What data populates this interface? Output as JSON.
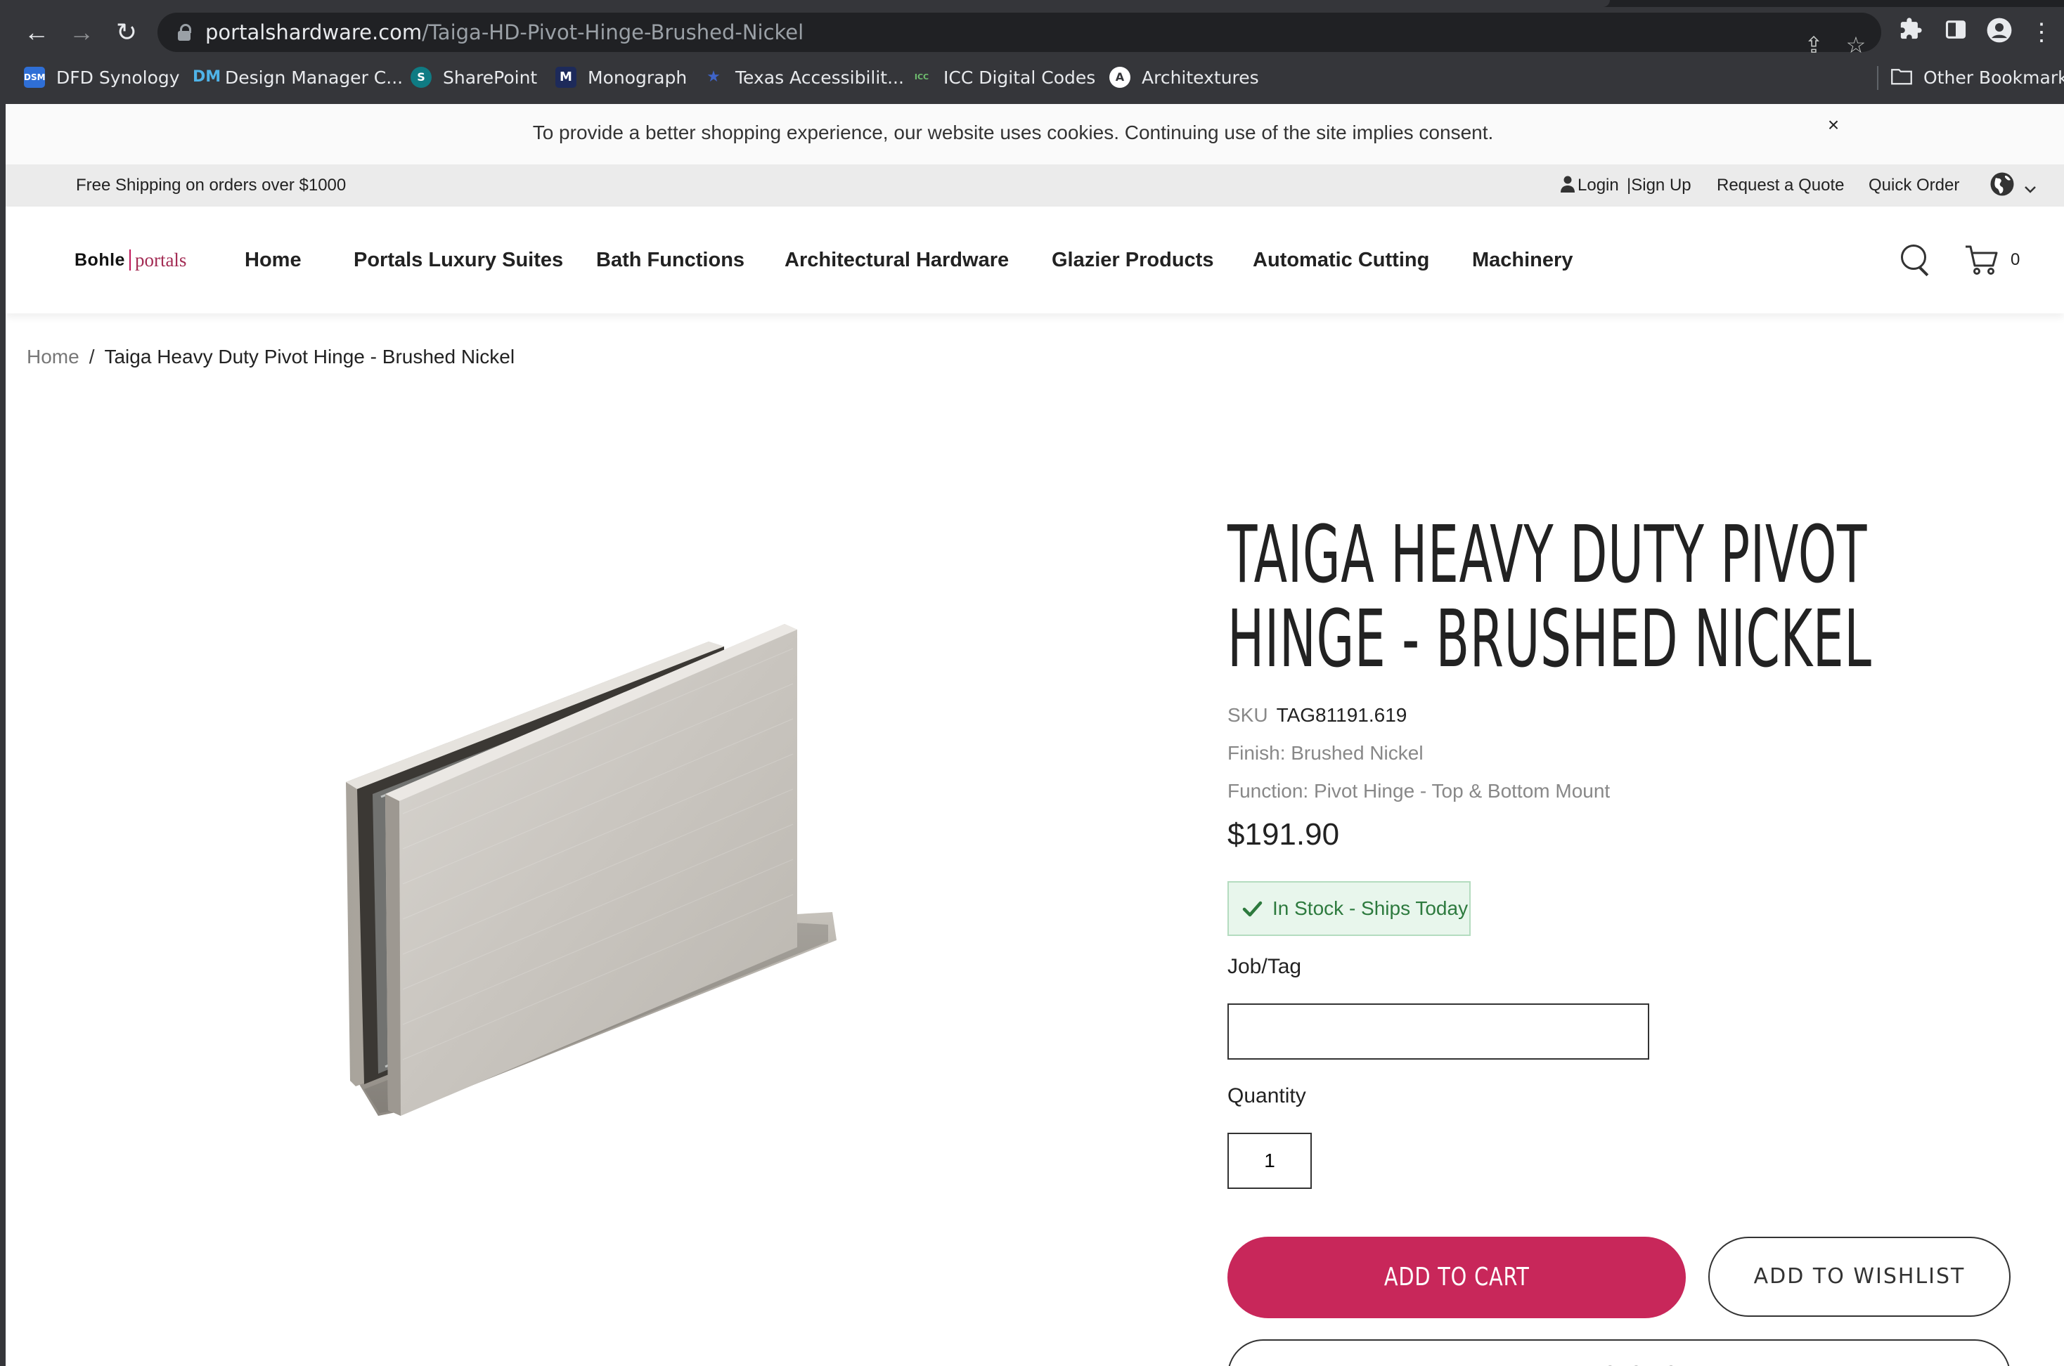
{
  "browser": {
    "url_host": "portalshardware.com",
    "url_path": "/Taiga-HD-Pivot-Hinge-Brushed-Nickel",
    "bookmarks": [
      {
        "label": "DFD Synology",
        "icon": "dsm-icon",
        "badge": "DSM",
        "color": "#2f6fd6"
      },
      {
        "label": "Design Manager C...",
        "icon": "design-manager-icon",
        "badge": "DM",
        "color": "#4fb3e8"
      },
      {
        "label": "SharePoint",
        "icon": "sharepoint-icon",
        "badge": "S",
        "color": "#0f7b83"
      },
      {
        "label": "Monograph",
        "icon": "monograph-icon",
        "badge": "M",
        "color": "#1d2a5a"
      },
      {
        "label": "Texas Accessibilit...",
        "icon": "texas-icon",
        "badge": "★",
        "color": "#1f3f8a"
      },
      {
        "label": "ICC Digital Codes",
        "icon": "icc-icon",
        "badge": "ICC",
        "color": "#3a7d3a"
      },
      {
        "label": "Architextures",
        "icon": "architextures-icon",
        "badge": "A",
        "color": "#ffffff"
      }
    ],
    "other_bookmarks": "Other Bookmarks"
  },
  "cookie_banner": {
    "message": "To provide a better shopping experience, our website uses cookies. Continuing use of the site implies consent.",
    "close": "×"
  },
  "utility_bar": {
    "shipping": "Free Shipping on orders over $1000",
    "login": "Login",
    "signup": "|Sign Up",
    "request_quote": "Request a Quote",
    "quick_order": "Quick Order"
  },
  "nav": {
    "logo_primary": "Bohle",
    "logo_secondary": "portals",
    "items": [
      "Home",
      "Portals Luxury Suites",
      "Bath Functions",
      "Architectural Hardware",
      "Glazier Products",
      "Automatic Cutting",
      "Machinery"
    ],
    "cart_count": "0"
  },
  "breadcrumb": {
    "home": "Home",
    "separator": "/",
    "current": "Taiga Heavy Duty Pivot Hinge - Brushed Nickel"
  },
  "product": {
    "title_line1": "TAIGA HEAVY DUTY PIVOT",
    "title_line2": "HINGE - BRUSHED NICKEL",
    "sku_label": "SKU",
    "sku": "TAG81191.619",
    "finish": "Finish: Brushed Nickel",
    "function": "Function: Pivot Hinge - Top & Bottom Mount",
    "price": "$191.90",
    "stock": "In Stock - Ships Today",
    "job_tag_label": "Job/Tag",
    "job_tag_value": "",
    "quantity_label": "Quantity",
    "quantity_value": "1",
    "add_to_cart": "ADD TO CART",
    "add_to_wishlist": "ADD TO WISHLIST",
    "add_to_quote": "ADD TO QUOTE"
  },
  "colors": {
    "accent": "#c8275a",
    "stock_bg": "#e8f6ec",
    "stock_text": "#2d7a3e",
    "chrome": "#35363a"
  }
}
